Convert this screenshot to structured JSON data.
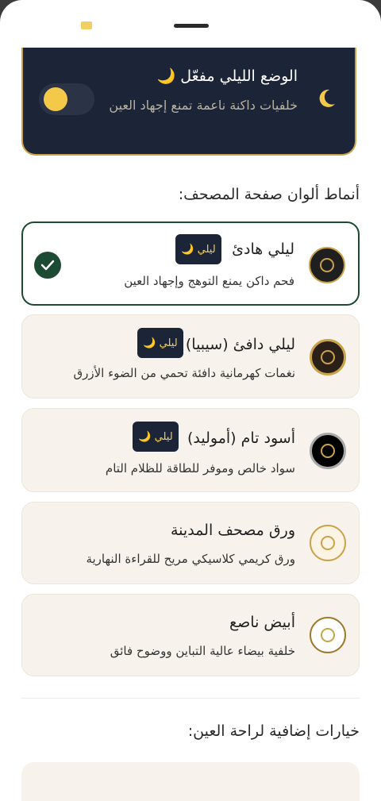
{
  "night_mode": {
    "title": "الوضع الليلي مفعّل 🌙",
    "subtitle": "خلفيات داكنة ناعمة تمنع إجهاد العين"
  },
  "section_title": "أنماط ألوان صفحة المصحف:",
  "extra_title": "خيارات إضافية لراحة العين:",
  "badge_label": "ليلي 🌙",
  "themes": [
    {
      "name": "ليلي هادئ",
      "desc": "فحم داكن يمنع التوهج وإجهاد العين",
      "selected": true
    },
    {
      "name": "ليلي دافئ (سيبيا)",
      "desc": "نغمات كهرمانية دافئة تحمي من الضوء الأزرق"
    },
    {
      "name": "أسود تام (أموليد)",
      "desc": "سواد خالص وموفر للطاقة للظلام التام"
    },
    {
      "name": "ورق مصحف المدينة",
      "desc": "ورق كريمي كلاسيكي مريح للقراءة النهارية"
    },
    {
      "name": "أبيض ناصع",
      "desc": "خلفية بيضاء عالية التباين ووضوح فائق"
    }
  ],
  "colors": {
    "accent": "#c9a34a",
    "night_bg": "#1c2438",
    "selected_border": "#1d4a33"
  }
}
